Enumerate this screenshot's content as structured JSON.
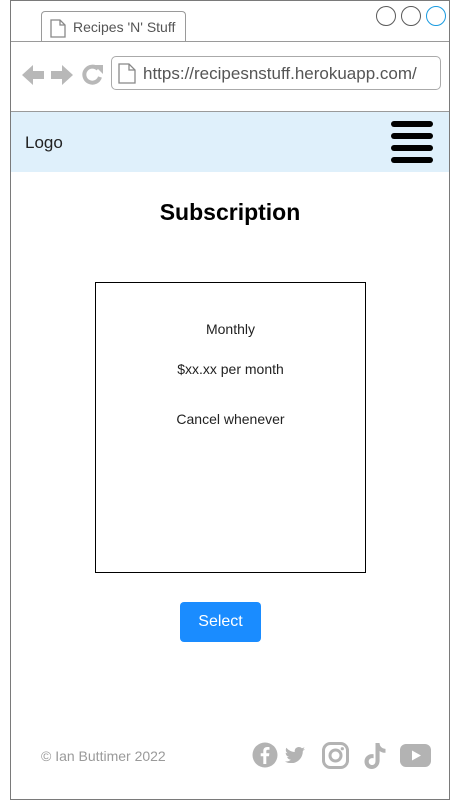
{
  "browser": {
    "tab_title": "Recipes 'N' Stuff",
    "url": "https://recipesnstuff.herokuapp.com/",
    "window_controls": [
      "minimize",
      "maximize",
      "close"
    ],
    "accent_color": "#1a9be0"
  },
  "header": {
    "logo_text": "Logo",
    "background_color": "#dff0fb",
    "menu_icon": "hamburger-menu-icon"
  },
  "main": {
    "title": "Subscription",
    "plan": {
      "name": "Monthly",
      "price": "$xx.xx per month",
      "note": "Cancel whenever"
    },
    "select_label": "Select",
    "button_color": "#1a8cff"
  },
  "footer": {
    "copyright": "© Ian Buttimer 2022",
    "social_icons": [
      "facebook-icon",
      "twitter-icon",
      "instagram-icon",
      "tiktok-icon",
      "youtube-icon"
    ],
    "icon_color": "#b3b3b3"
  }
}
